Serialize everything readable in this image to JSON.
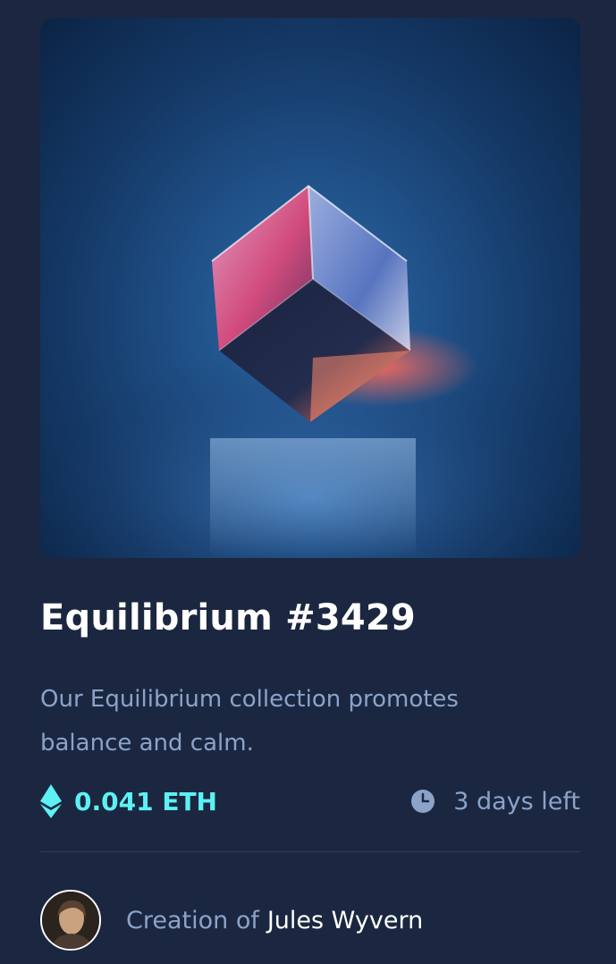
{
  "nft": {
    "image_alt": "Equilibrium glass cube",
    "title": "Equilibrium #3429",
    "description": "Our Equilibrium collection promotes balance and calm.",
    "price": "0.041 ETH",
    "time_left": "3 days left"
  },
  "creator": {
    "label": "Creation of",
    "name": "Jules Wyvern"
  },
  "icons": {
    "price_icon": "ethereum-icon",
    "time_icon": "clock-icon"
  },
  "colors": {
    "background": "#1b2740",
    "accent_cyan": "#5df1f3",
    "muted_text": "#8ba3c9",
    "title_text": "#ffffff",
    "divider": "#2f3d59"
  }
}
